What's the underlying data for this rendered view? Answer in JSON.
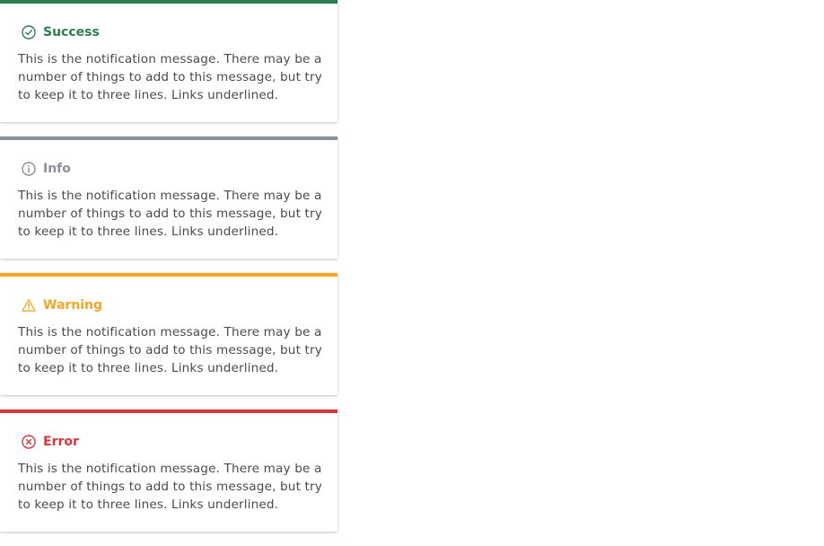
{
  "notifications": [
    {
      "type": "success",
      "title": "Success",
      "icon": "check-circle-icon",
      "color": "#2e7d4f",
      "message": "This is the notification message. There may be a number of things to add to this message, but try to keep it to three lines. Links underlined."
    },
    {
      "type": "info",
      "title": "Info",
      "icon": "info-circle-icon",
      "color": "#8a8f99",
      "message": "This is the notification message. There may be a number of things to add to this message, but try to keep it to three lines. Links underlined."
    },
    {
      "type": "warning",
      "title": "Warning",
      "icon": "warning-triangle-icon",
      "color": "#f5a623",
      "message": "This is the notification message. There may be a number of things to add to this message, but try to keep it to three lines. Links underlined."
    },
    {
      "type": "error",
      "title": "Error",
      "icon": "error-circle-icon",
      "color": "#d9363e",
      "message": "This is the notification message. There may be a number of things to add to this message, but try to keep it to three lines. Links underlined."
    }
  ]
}
